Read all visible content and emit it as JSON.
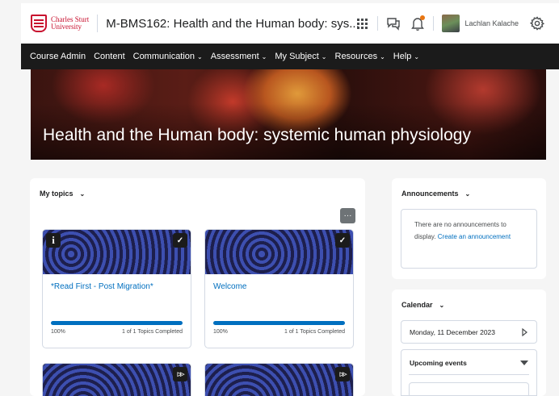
{
  "brand": {
    "name_line1": "Charles Sturt",
    "name_line2": "University"
  },
  "header": {
    "course_title": "M-BMS162: Health and the Human body: sys...",
    "user_name": "Lachlan Kalache",
    "icons": [
      "apps-grid-icon",
      "message-icon",
      "bell-icon",
      "gear-icon"
    ]
  },
  "nav": {
    "items": [
      {
        "label": "Course Admin",
        "dropdown": false
      },
      {
        "label": "Content",
        "dropdown": false
      },
      {
        "label": "Communication",
        "dropdown": true
      },
      {
        "label": "Assessment",
        "dropdown": true
      },
      {
        "label": "My Subject",
        "dropdown": true
      },
      {
        "label": "Resources",
        "dropdown": true
      },
      {
        "label": "Help",
        "dropdown": true
      }
    ]
  },
  "banner": {
    "title": "Health and the Human body: systemic human physiology"
  },
  "topics": {
    "heading": "My topics",
    "more_label": "···",
    "cards": [
      {
        "title": "*Read First - Post Migration*",
        "progress_percent": 100,
        "progress_label": "100%",
        "completed_text": "1 of 1 Topics Completed",
        "badge_left": "i",
        "badge_right": "✓"
      },
      {
        "title": "Welcome",
        "progress_percent": 100,
        "progress_label": "100%",
        "completed_text": "1 of 1 Topics Completed",
        "badge_right": "✓"
      },
      {
        "badge_right": "▷▷"
      },
      {
        "badge_right": "▷▷"
      }
    ]
  },
  "announcements": {
    "heading": "Announcements",
    "empty_text": "There are no announcements to display.",
    "create_link": "Create an announcement"
  },
  "calendar": {
    "heading": "Calendar",
    "date": "Monday, 11 December 2023",
    "events_heading": "Upcoming events"
  },
  "colors": {
    "brand_red": "#c8102e",
    "nav_bg": "#1b1b1b",
    "link_blue": "#006fbf",
    "notification_dot": "#e87511"
  }
}
